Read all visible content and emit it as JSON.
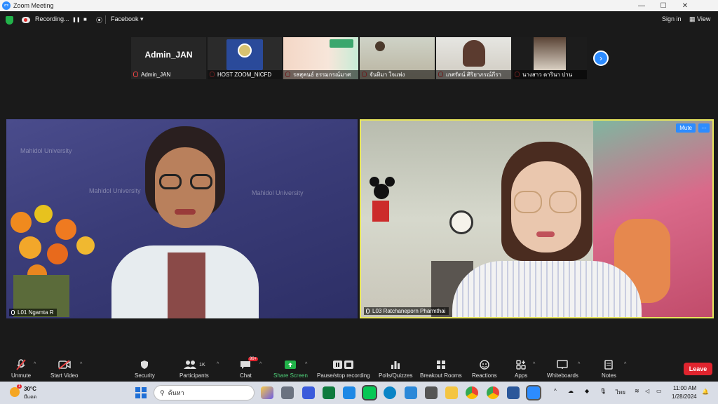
{
  "window": {
    "title": "Zoom Meeting",
    "icon": "zoom-icon"
  },
  "topbar": {
    "recording_label": "Recording...",
    "pause_symbol": "❚❚",
    "stop_symbol": "■",
    "stream_label": "Facebook ▾",
    "sign_in": "Sign in",
    "view": "View"
  },
  "thumbnails": [
    {
      "name": "Admin_JAN",
      "display": "Admin_JAN"
    },
    {
      "name": "HOST ZOOM_NICFD"
    },
    {
      "name": "รสสุคนธ์ ธรรมกรณ์มาศ"
    },
    {
      "name": "จันทิมา ใจแพ่ง"
    },
    {
      "name": "เกศรัตน์ ศิริยาภรณ์กีรา"
    },
    {
      "name": "นางสาว ดารินา ปาน"
    }
  ],
  "tiles": {
    "left": {
      "name": "L01 Ngamta R",
      "watermark": "Mahidol University"
    },
    "right": {
      "name": "L03 Ratchaneporn Pharmthai",
      "mute": "Mute",
      "more": "···"
    }
  },
  "toolbar": {
    "unmute": "Unmute",
    "start_video": "Start Video",
    "security": "Security",
    "participants": "Participants",
    "participants_count": "1K",
    "chat": "Chat",
    "chat_badge": "99+",
    "share_screen": "Share Screen",
    "pause_recording": "Pause/stop recording",
    "polls": "Polls/Quizzes",
    "breakout": "Breakout Rooms",
    "reactions": "Reactions",
    "apps": "Apps",
    "whiteboards": "Whiteboards",
    "notes": "Notes",
    "leave": "Leave"
  },
  "taskbar": {
    "weather_temp": "30°C",
    "weather_desc": "มีแดด",
    "search_placeholder": "ค้นหา",
    "lang": "ไทย",
    "time": "11:00 AM",
    "date": "1/28/2024"
  },
  "colors": {
    "zoom_blue": "#2d8cff",
    "leave_red": "#e0242e",
    "active_speaker": "#e8e65c",
    "share_green": "#22b34a"
  }
}
